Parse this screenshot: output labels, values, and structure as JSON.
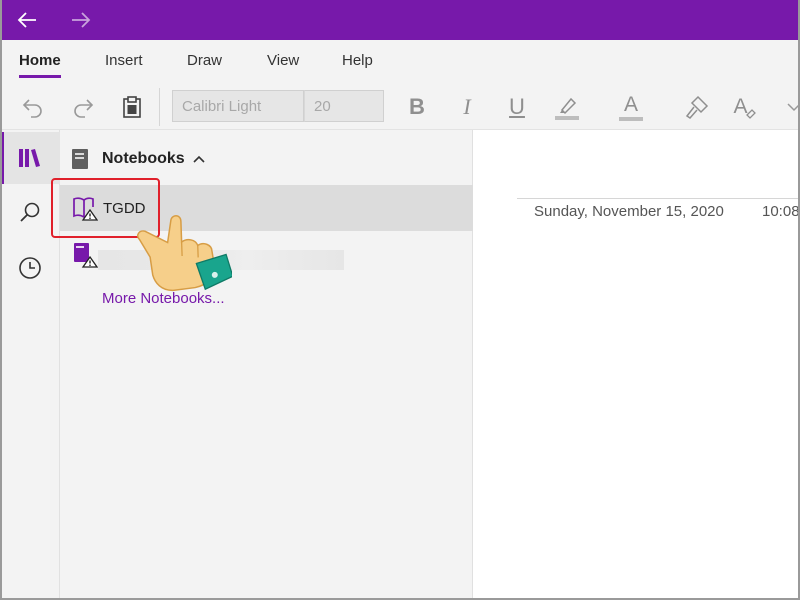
{
  "colors": {
    "accent": "#7719aa",
    "highlight_box": "#e0202b",
    "hand_skin": "#f6cf8a",
    "hand_cuff": "#19a58d"
  },
  "titlebar": {
    "back_icon": "arrow-left-icon",
    "forward_icon": "arrow-right-icon"
  },
  "tabs": [
    {
      "label": "Home",
      "active": true
    },
    {
      "label": "Insert"
    },
    {
      "label": "Draw"
    },
    {
      "label": "View"
    },
    {
      "label": "Help"
    }
  ],
  "toolbar": {
    "font_name": "Calibri Light",
    "font_size": "20",
    "bold": "B",
    "italic": "I",
    "underline": "U",
    "font_color": "A",
    "text_effects": "A",
    "icons": [
      "undo-icon",
      "redo-icon",
      "clipboard-icon",
      "highlighter-icon",
      "format-painter-icon",
      "clear-formatting-icon",
      "chevron-down-icon"
    ]
  },
  "rail": {
    "items": [
      "notebooks-icon",
      "search-icon",
      "recent-clock-icon"
    ]
  },
  "notebooks_pane": {
    "header": "Notebooks",
    "items": [
      {
        "label": "TGDD",
        "selected": true,
        "icon": "open-book-warning-icon"
      },
      {
        "label": "",
        "icon": "notebook-warning-icon",
        "blurred": true
      }
    ],
    "more_link": "More Notebooks..."
  },
  "page": {
    "date": "Sunday, November 15, 2020",
    "time": "10:08"
  }
}
